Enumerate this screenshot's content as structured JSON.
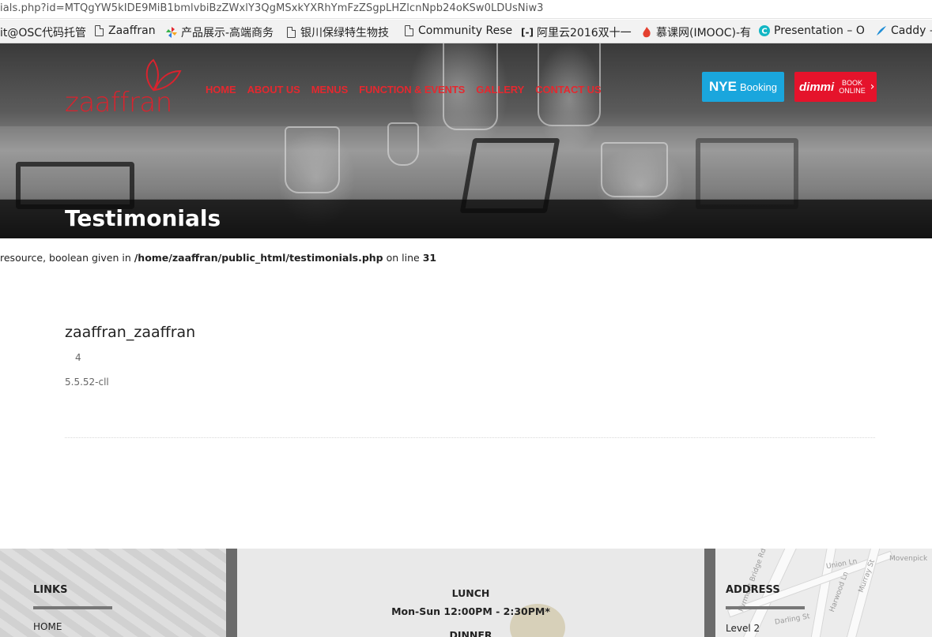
{
  "browser": {
    "url": "ials.php?id=MTQgYW5kIDE9MiB1bmlvbiBzZWxlY3QgMSxkYXRhYmFzZSgpLHZlcnNpb24oKSw0LDUsNiw3",
    "bookmarks": [
      {
        "label": "it@OSC代码托管",
        "icon": "none"
      },
      {
        "label": "Zaaffran",
        "icon": "page"
      },
      {
        "label": "产品展示-高端商务",
        "icon": "pinwheel"
      },
      {
        "label": "银川保绿特生物技",
        "icon": "page"
      },
      {
        "label": "Community Rese",
        "icon": "page"
      },
      {
        "label": "阿里云2016双十一",
        "icon": "aliyun"
      },
      {
        "label": "慕课网(IMOOC)-有",
        "icon": "flame"
      },
      {
        "label": "Presentation – O",
        "icon": "circle-c"
      },
      {
        "label": "Caddy –",
        "icon": "caddy"
      }
    ]
  },
  "site": {
    "logo_text": "zaaffran",
    "nav": [
      "HOME",
      "ABOUT US",
      "MENUS",
      "FUNCTION & EVENTS",
      "GALLERY",
      "CONTACT US"
    ],
    "nye_button": {
      "big": "NYE",
      "small": "Booking"
    },
    "dimmi_button": {
      "brand": "dimmi",
      "line1": "BOOK",
      "line2": "ONLINE"
    },
    "page_title": "Testimonials",
    "colors": {
      "brand_red": "#e4282f",
      "nye_blue": "#1aa6dd",
      "dimmi_red": "#e5132b"
    }
  },
  "content": {
    "warning_prefix": "resource, boolean given in ",
    "warning_path": "/home/zaaffran/public_html/testimonials.php",
    "warning_mid": " on line ",
    "warning_line": "31",
    "db_name": "zaaffran_zaaffran",
    "db_number": "4",
    "db_version": "5.5.52-cll"
  },
  "footer": {
    "links_heading": "LINKS",
    "links": [
      "HOME"
    ],
    "lunch_heading": "LUNCH",
    "lunch_hours": "Mon-Sun 12:00PM - 2:30PM*",
    "dinner_heading": "DINNER",
    "address_heading": "ADDRESS",
    "address_line1": "Level 2",
    "map_labels": [
      "Pyrmont Bridge Rd",
      "Union Ln",
      "Harwood Ln",
      "Murray St",
      "Darling St",
      "Movenpick"
    ]
  }
}
